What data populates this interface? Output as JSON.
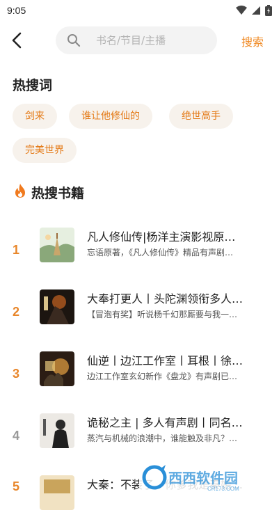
{
  "status_bar": {
    "time": "9:05",
    "icons": [
      "wifi-icon",
      "signal-icon",
      "battery-icon"
    ]
  },
  "header": {
    "back_icon": "chevron-left-icon",
    "search": {
      "placeholder": "书名/节目/主播",
      "value": ""
    },
    "search_button": "搜索"
  },
  "hot_words": {
    "title": "热搜词",
    "tags": [
      "剑来",
      "谁让他修仙的",
      "绝世高手",
      "完美世界"
    ]
  },
  "hot_books": {
    "title": "热搜书籍",
    "icon": "fire-icon",
    "items": [
      {
        "rank": "1",
        "title": "凡人修仙传|杨洋主演影视原…",
        "desc": "忘语原著，《凡人修仙传》精品有声剧…"
      },
      {
        "rank": "2",
        "title": "大奉打更人丨头陀渊领衔多人…",
        "desc": "【冒泡有奖】听说杨千幻那厮要与我一…"
      },
      {
        "rank": "3",
        "title": "仙逆丨边江工作室丨耳根丨徐…",
        "desc": "边江工作室玄幻新作《盘龙》有声剧已…"
      },
      {
        "rank": "4",
        "title": "诡秘之主 | 多人有声剧丨同名…",
        "desc": "蒸汽与机械的浪潮中，谁能触及非凡？…"
      },
      {
        "rank": "5",
        "title": "大秦：不装了，你爹我是秦始…",
        "desc": ""
      }
    ]
  },
  "colors": {
    "accent": "#F08A24",
    "tag_bg": "#F7F2EC",
    "rank_top": "#E8862A",
    "rank_other": "#999999"
  },
  "watermark": {
    "text": "西西软件园",
    "subtext": "CR173.COM"
  }
}
